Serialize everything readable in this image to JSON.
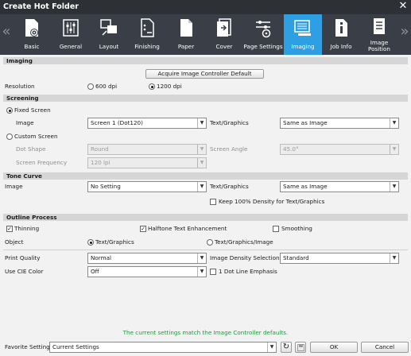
{
  "window": {
    "title": "Create Hot Folder",
    "close_glyph": "✕"
  },
  "nav": {
    "prev_glyph": "«",
    "next_glyph": "»"
  },
  "tabs": [
    {
      "label": "Basic",
      "icon": "folder-gear-icon"
    },
    {
      "label": "General",
      "icon": "sliders-icon"
    },
    {
      "label": "Layout",
      "icon": "layout-icon"
    },
    {
      "label": "Finishing",
      "icon": "finishing-icon"
    },
    {
      "label": "Paper",
      "icon": "paper-icon"
    },
    {
      "label": "Cover",
      "icon": "cover-icon"
    },
    {
      "label": "Page Settings",
      "icon": "page-settings-icon"
    },
    {
      "label": "Imaging",
      "icon": "imaging-icon",
      "active": true
    },
    {
      "label": "Job Info",
      "icon": "info-icon"
    },
    {
      "label": "Image Position",
      "icon": "image-position-icon"
    }
  ],
  "imaging": {
    "header": "Imaging",
    "acquire_button": "Acquire Image Controller Default",
    "resolution_label": "Resolution",
    "res_600": "600 dpi",
    "res_1200": "1200 dpi"
  },
  "screening": {
    "header": "Screening",
    "fixed_label": "Fixed Screen",
    "image_label": "Image",
    "image_value": "Screen 1 (Dot120)",
    "textgraphics_label": "Text/Graphics",
    "textgraphics_value": "Same as Image",
    "custom_label": "Custom Screen",
    "dot_shape_label": "Dot Shape",
    "dot_shape_value": "Round",
    "angle_label": "Screen Angle",
    "angle_value": "45.0°",
    "freq_label": "Screen Frequency",
    "freq_value": "120 lpi"
  },
  "tone_curve": {
    "header": "Tone Curve",
    "image_label": "Image",
    "image_value": "No Setting",
    "textgraphics_label": "Text/Graphics",
    "textgraphics_value": "Same as Image",
    "keep_density_label": "Keep 100% Density for Text/Graphics"
  },
  "outline": {
    "header": "Outline Process",
    "thinning_label": "Thinning",
    "halftone_label": "Halftone Text Enhancement",
    "smoothing_label": "Smoothing",
    "object_label": "Object",
    "obj_tg": "Text/Graphics",
    "obj_tgi": "Text/Graphics/Image"
  },
  "quality": {
    "print_quality_label": "Print Quality",
    "print_quality_value": "Normal",
    "density_label": "Image Density Selection",
    "density_value": "Standard",
    "cie_label": "Use CIE Color",
    "cie_value": "Off",
    "dot_line_label": "1 Dot Line Emphasis"
  },
  "status_message": "The current settings match the Image Controller defaults.",
  "footer": {
    "favorite_label": "Favorite Setting",
    "favorite_value": "Current Settings",
    "ok_label": "OK",
    "cancel_label": "Cancel"
  }
}
